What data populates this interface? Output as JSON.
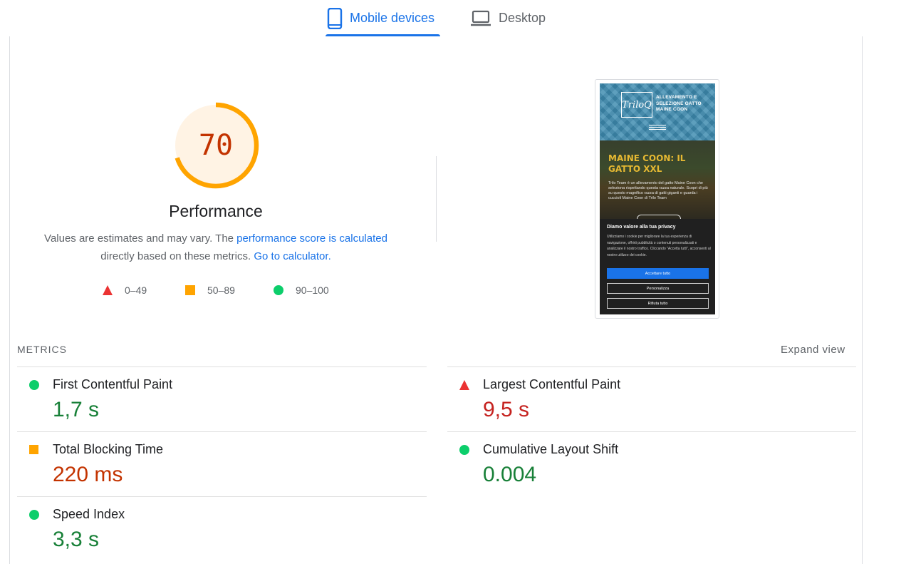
{
  "tabs": [
    {
      "label": "Mobile devices",
      "icon": "smartphone-icon",
      "active": true
    },
    {
      "label": "Desktop",
      "icon": "laptop-icon",
      "active": false
    }
  ],
  "score": {
    "value": "70",
    "fraction": 0.7,
    "title": "Performance",
    "status_color": "#ffa400",
    "desc_prefix": "Values are estimates and may vary. The ",
    "desc_link": "performance score is calculated",
    "desc_middle": "directly based on these metrics. ",
    "desc_link2": "Go to calculator."
  },
  "legend": [
    {
      "icon": "triangle-fail-icon",
      "label": "0–49",
      "color": "#eb3333"
    },
    {
      "icon": "square-average-icon",
      "label": "50–89",
      "color": "#ffa400"
    },
    {
      "icon": "circle-pass-icon",
      "label": "90–100",
      "color": "#0cce6b"
    }
  ],
  "preview": {
    "logo": "TriloQ",
    "brand": "ALLEVAMENTO E SELEZIONE GATTO MAINE COON",
    "hero_title": "MAINE COON: IL GATTO XXL",
    "hero_text": "Trilo Team è un allevamento del gatto Maine Coon che seleziona rispettando questa razza naturale. Scopri di più su questo magnifico razza di gatti giganti e guarda i cuccioli Maine Coon di Trilo Team",
    "cookie_title": "Diamo valore alla tua privacy",
    "cookie_text": "Utilizziamo i cookie per migliorare la tua esperienza di navigazione, offrirti pubblicità o contenuti personalizzati e analizzare il nostro traffico. Cliccando \"Accetta tutti\", acconsenti al nostro utilizzo dei cookie.",
    "btn_accept": "Accettare tutto",
    "btn_customize": "Personalizza",
    "btn_reject": "Rifiuta tutto"
  },
  "metrics": {
    "section_label": "METRICS",
    "expand_label": "Expand view",
    "items": [
      {
        "name": "First Contentful Paint",
        "value": "1,7 s",
        "rating": "pass"
      },
      {
        "name": "Largest Contentful Paint",
        "value": "9,5 s",
        "rating": "fail"
      },
      {
        "name": "Total Blocking Time",
        "value": "220 ms",
        "rating": "average"
      },
      {
        "name": "Cumulative Layout Shift",
        "value": "0.004",
        "rating": "pass"
      },
      {
        "name": "Speed Index",
        "value": "3,3 s",
        "rating": "pass"
      }
    ]
  },
  "colors": {
    "accent": "#1a73e8",
    "pass": "#0cce6b",
    "average": "#ffa400",
    "fail": "#eb3333",
    "text_pass": "#188038",
    "text_fail": "#c5221f",
    "text_average": "#c33300"
  }
}
